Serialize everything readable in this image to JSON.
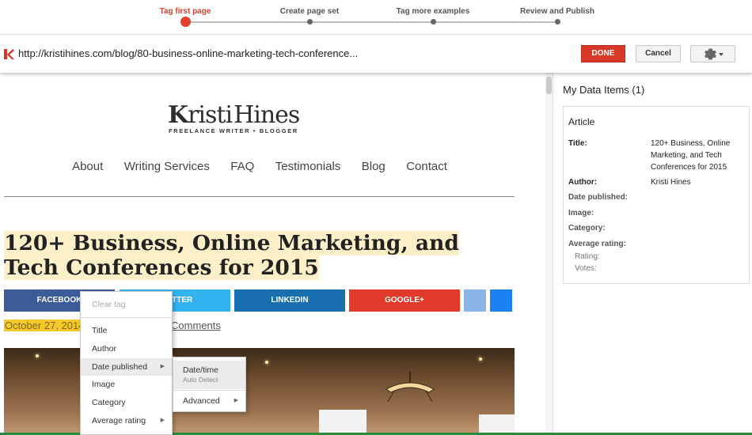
{
  "stepper": {
    "steps": [
      {
        "label": "Tag first page",
        "active": true
      },
      {
        "label": "Create page set",
        "active": false
      },
      {
        "label": "Tag more examples",
        "active": false
      },
      {
        "label": "Review and Publish",
        "active": false
      }
    ],
    "accent_color": "#e0402c"
  },
  "toolbar": {
    "url": "http://kristihines.com/blog/80-business-online-marketing-tech-conference...",
    "done_label": "DONE",
    "cancel_label": "Cancel",
    "settings_icon": "gear-icon"
  },
  "site": {
    "logo_k": "K",
    "logo_rest": "risti",
    "logo_last": "Hines",
    "logo_tagline": "FREELANCE WRITER • BLOGGER",
    "nav": [
      "About",
      "Writing Services",
      "FAQ",
      "Testimonials",
      "Blog",
      "Contact"
    ],
    "post_title": "120+ Business, Online Marketing, and Tech Conferences for 2015",
    "share_buttons": [
      {
        "label": "FACEBOOK",
        "color": "#3b5b99"
      },
      {
        "label": "TWITTER",
        "color": "#34b3f1"
      },
      {
        "label": "LINKEDIN",
        "color": "#1a6fb1"
      },
      {
        "label": "GOOGLE+",
        "color": "#e13a2a"
      }
    ],
    "post_date": "October 27, 2014",
    "comments_label": "Comments"
  },
  "context_menu": {
    "items": [
      {
        "label": "Clear tag",
        "disabled": true
      },
      {
        "label": "Title"
      },
      {
        "label": "Author"
      },
      {
        "label": "Date published",
        "has_submenu": true,
        "highlighted": true
      },
      {
        "label": "Image"
      },
      {
        "label": "Category"
      },
      {
        "label": "Average rating",
        "has_submenu": true
      }
    ],
    "submenu": [
      {
        "label": "Date/time",
        "hint": "Auto Detect",
        "highlighted": true
      },
      {
        "label": "Advanced",
        "has_submenu": true
      }
    ]
  },
  "panel": {
    "title": "My Data Items (1)",
    "card_title": "Article",
    "properties": [
      {
        "label": "Title:",
        "value": "120+ Business, Online Marketing, and Tech Conferences for 2015"
      },
      {
        "label": "Author:",
        "value": "Kristi Hines"
      },
      {
        "label": "Date published:",
        "value": ""
      },
      {
        "label": "Image:",
        "value": ""
      },
      {
        "label": "Category:",
        "value": ""
      },
      {
        "label": "Average rating:",
        "value": ""
      },
      {
        "label": "Rating:",
        "value": ""
      },
      {
        "label": "Votes:",
        "value": ""
      }
    ]
  }
}
